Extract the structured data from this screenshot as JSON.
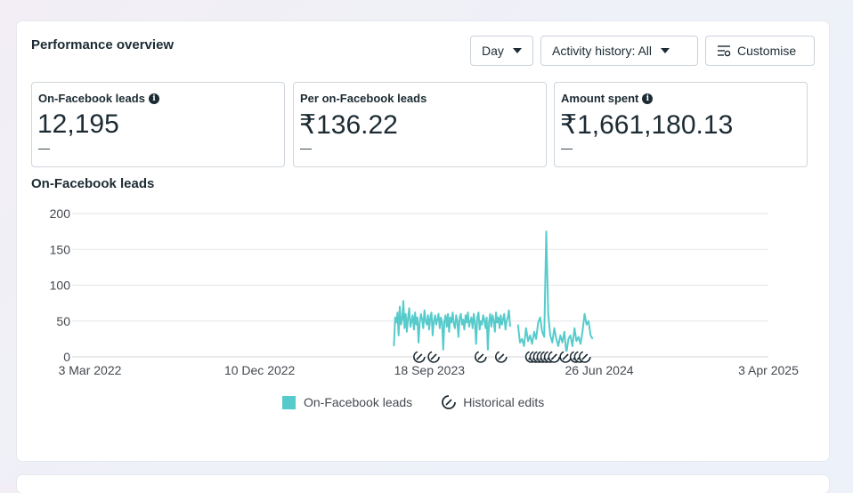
{
  "header": {
    "title": "Performance overview",
    "day_label": "Day",
    "activity_label": "Activity history: All",
    "customise_label": "Customise"
  },
  "metrics": [
    {
      "label": "On-Facebook leads",
      "value": "12,195",
      "delta": "—",
      "has_info": true
    },
    {
      "label": "Per on-Facebook leads",
      "value": "₹136.22",
      "delta": "—",
      "has_info": false
    },
    {
      "label": "Amount spent",
      "value": "₹1,661,180.13",
      "delta": "—",
      "has_info": true
    }
  ],
  "chart_title": "On-Facebook leads",
  "legend": {
    "series_label": "On-Facebook leads",
    "edits_label": "Historical edits"
  },
  "colors": {
    "series": "#57cbcb",
    "text": "#1c2b33",
    "grid": "#e4e6eb"
  },
  "chart_data": {
    "type": "line",
    "title": "On-Facebook leads",
    "ylim": [
      0,
      200
    ],
    "y_ticks": [
      0,
      50,
      100,
      150,
      200
    ],
    "x_ticks": [
      "3 Mar 2022",
      "10 Dec 2022",
      "18 Sep 2023",
      "26 Jun 2024",
      "3 Apr 2025"
    ],
    "series": [
      {
        "name": "On-Facebook leads",
        "segments": [
          {
            "start": "2023-07-21",
            "end": "2024-01-30",
            "values": [
              15,
              55,
              48,
              62,
              30,
              70,
              45,
              52,
              78,
              40,
              60,
              35,
              55,
              68,
              42,
              50,
              58,
              38,
              62,
              45,
              55,
              20,
              48,
              60,
              52,
              40,
              65,
              50,
              45,
              58,
              38,
              55,
              62,
              30,
              50,
              58,
              45,
              52,
              60,
              40,
              55,
              48,
              10,
              50,
              58,
              42,
              60,
              35,
              55,
              48,
              62,
              45,
              40,
              58,
              50,
              28,
              55,
              60,
              45,
              52,
              38,
              58,
              48,
              62,
              42,
              50,
              55,
              40,
              60,
              48,
              18,
              55,
              62,
              38,
              50,
              45,
              58,
              52,
              40,
              55,
              10,
              48,
              60,
              42,
              58,
              50,
              35,
              62,
              48,
              55,
              40,
              58,
              45,
              52,
              60,
              38,
              50,
              55,
              65,
              42
            ]
          },
          {
            "start": "2024-02-12",
            "end": "2024-06-15",
            "values": [
              45,
              20,
              25,
              15,
              40,
              22,
              30,
              18,
              35,
              25,
              48,
              55,
              35,
              28,
              175,
              60,
              30,
              20,
              40,
              25,
              15,
              30,
              20,
              35,
              5,
              25,
              30,
              15,
              40,
              22,
              28,
              18,
              35,
              60,
              45,
              50,
              30,
              25
            ]
          }
        ]
      }
    ],
    "historical_edits": [
      "2023-09-01",
      "2023-09-25",
      "2023-12-12",
      "2024-01-15",
      "2024-03-05",
      "2024-03-12",
      "2024-03-18",
      "2024-03-24",
      "2024-03-30",
      "2024-04-05",
      "2024-04-12",
      "2024-05-01",
      "2024-05-18",
      "2024-05-25",
      "2024-06-02"
    ]
  }
}
